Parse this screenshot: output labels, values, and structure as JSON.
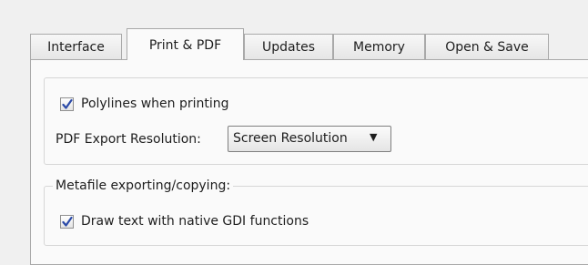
{
  "tabs": [
    {
      "label": "Interface"
    },
    {
      "label": "Print & PDF"
    },
    {
      "label": "Updates"
    },
    {
      "label": "Memory"
    },
    {
      "label": "Open & Save"
    }
  ],
  "active_tab": "Print & PDF",
  "print_group": {
    "polylines_label": "Polylines when printing",
    "polylines_checked": true,
    "pdf_res_label": "PDF Export Resolution:",
    "pdf_res_value": "Screen Resolution",
    "pdf_res_arrow": "▼"
  },
  "metafile_group": {
    "title": "Metafile exporting/copying:",
    "gdi_label": "Draw text with native GDI functions",
    "gdi_checked": true
  },
  "colors": {
    "check_mark": "#2b4aa8",
    "border": "#a9a9a9",
    "panel_bg": "#fafafa"
  }
}
